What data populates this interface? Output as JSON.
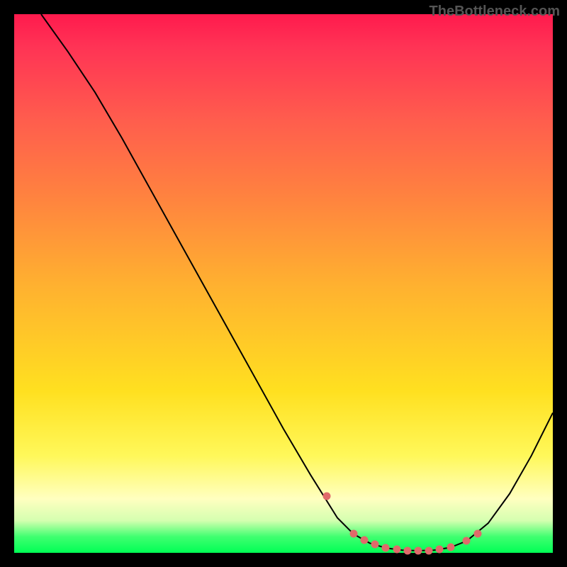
{
  "watermark": "TheBottleneck.com",
  "chart_data": {
    "type": "line",
    "title": "",
    "xlabel": "",
    "ylabel": "",
    "xlim": [
      0,
      100
    ],
    "ylim": [
      0,
      100
    ],
    "grid": false,
    "series": [
      {
        "name": "curve",
        "x": [
          5,
          10,
          15,
          20,
          25,
          30,
          35,
          40,
          45,
          50,
          55,
          60,
          63,
          66,
          69,
          72,
          75,
          78,
          81,
          84,
          88,
          92,
          96,
          100
        ],
        "values": [
          100,
          93,
          85.5,
          77,
          68,
          59,
          50,
          41,
          32,
          23,
          14.5,
          6.5,
          3.5,
          1.8,
          0.9,
          0.5,
          0.4,
          0.5,
          1.0,
          2.2,
          5.5,
          11,
          18,
          26
        ]
      }
    ],
    "markers": {
      "name": "highlight",
      "x": [
        58,
        63,
        65,
        67,
        69,
        71,
        73,
        75,
        77,
        79,
        81,
        84,
        86
      ],
      "values": [
        10.5,
        3.5,
        2.4,
        1.6,
        0.9,
        0.6,
        0.45,
        0.4,
        0.45,
        0.7,
        1.0,
        2.2,
        3.6
      ]
    }
  }
}
